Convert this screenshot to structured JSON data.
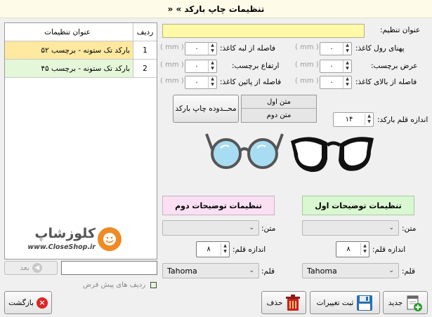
{
  "window": {
    "title": "تنظیمات چاپ بارکد »",
    "title_marker": "«"
  },
  "table": {
    "headers": [
      "ردیف",
      "عنوان تنظیمات"
    ],
    "rows": [
      {
        "id": "1",
        "title": "بارکد تک ستونه - برچسب ۵۲"
      },
      {
        "id": "2",
        "title": "بارکد تک ستونه - برچسب ۴۵"
      }
    ],
    "search_placeholder": "",
    "next_label": "بعد"
  },
  "default_row": {
    "label": "ردیف های پیش فرض"
  },
  "form": {
    "name_label": "عنوان تنظیم:",
    "name_value": "",
    "unit": "( mm )",
    "fields": [
      {
        "key": "roll_width",
        "label": "پهنای رول کاغذ:",
        "value": "۰"
      },
      {
        "key": "edge_gap",
        "label": "فاصله از لبه کاغذ:",
        "value": "۰"
      },
      {
        "key": "label_width",
        "label": "عرض برچسب:",
        "value": "۰"
      },
      {
        "key": "label_height",
        "label": "ارتفاع برچسب:",
        "value": "۰"
      },
      {
        "key": "top_gap",
        "label": "فاصله از بالای کاغذ:",
        "value": "۰"
      },
      {
        "key": "bottom_gap",
        "label": "فاصله از پائین کاغذ:",
        "value": "۰"
      }
    ],
    "print_area_button": "محــدوده چاپ بارکد",
    "text_first": "متن اول",
    "text_second": "متن دوم",
    "barcode_font_label": "اندازه قلم بارکد:",
    "barcode_font_value": "۱۴"
  },
  "desc1": {
    "header": "تنظیمات توضیحات اول",
    "text_label": "متن:",
    "text_value": "",
    "size_label": "اندازه قلم:",
    "size_value": "۸",
    "font_label": "قلم:",
    "font_value": "Tahoma",
    "color": "#d9f7d0"
  },
  "desc2": {
    "header": "تنظیمات توضیحات دوم",
    "text_label": "متن:",
    "text_value": "",
    "size_label": "اندازه قلم:",
    "size_value": "۸",
    "font_label": "قلم:",
    "font_value": "Tahoma",
    "color": "#fbe0f4"
  },
  "watermark": {
    "brand": "کلوزشاپ",
    "url": "www.CloseShop.ir"
  },
  "toolbar": {
    "new": "جدید",
    "save": "ثبت تغییرات",
    "delete": "حذف",
    "back": "بازگشت"
  },
  "colors": {
    "name_field": "#fff9a8",
    "row_selected": "#ffe8a0",
    "row_alt": "#e4f7d8"
  }
}
